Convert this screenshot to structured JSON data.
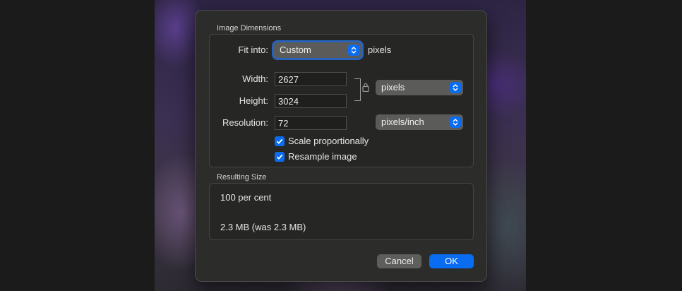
{
  "image_dimensions": {
    "section_title": "Image Dimensions",
    "fit_into": {
      "label": "Fit into:",
      "value": "Custom",
      "unit": "pixels"
    },
    "width": {
      "label": "Width:",
      "value": "2627"
    },
    "height": {
      "label": "Height:",
      "value": "3024"
    },
    "size_unit": "pixels",
    "resolution": {
      "label": "Resolution:",
      "value": "72",
      "unit": "pixels/inch"
    },
    "scale_proportionally": {
      "label": "Scale proportionally",
      "checked": true
    },
    "resample_image": {
      "label": "Resample image",
      "checked": true
    }
  },
  "resulting_size": {
    "section_title": "Resulting Size",
    "percent": "100 per cent",
    "file_size": "2.3 MB (was 2.3 MB)"
  },
  "buttons": {
    "cancel": "Cancel",
    "ok": "OK"
  },
  "colors": {
    "accent": "#0a6cf0",
    "dialog_bg": "#2c2d2b"
  }
}
